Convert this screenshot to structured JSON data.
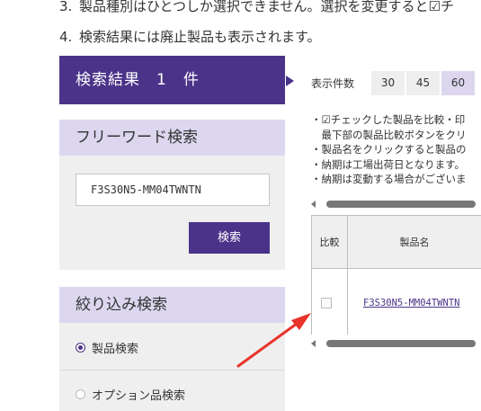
{
  "notes": {
    "n3_num": "3.",
    "n3_text": "製品種別はひとつしか選択できません。選択を変更すると☑チ",
    "n4_num": "4.",
    "n4_text": "検索結果には廃止製品も表示されます。"
  },
  "result": {
    "label": "検索結果　1　件"
  },
  "freeword": {
    "title": "フリーワード検索",
    "value": "F3S30N5-MM04TWNTN",
    "button": "検索"
  },
  "narrow": {
    "title": "絞り込み検索",
    "options": [
      {
        "label": "製品検索",
        "selected": true
      },
      {
        "label": "オプション品検索",
        "selected": false
      }
    ]
  },
  "count": {
    "label": "表示件数",
    "options": [
      "30",
      "45",
      "60"
    ],
    "selected": "60"
  },
  "bullets": [
    "・☑チェックした製品を比較・印",
    "　最下部の製品比較ボタンをクリ",
    "・製品名をクリックすると製品の",
    "・納期は工場出荷日となります。",
    "・納期は変動する場合がございま"
  ],
  "table": {
    "headers": [
      "比較",
      "製品名"
    ],
    "rows": [
      {
        "product": "F3S30N5-MM04TWNTN"
      }
    ]
  },
  "colors": {
    "accent": "#4a3389",
    "panel_head": "#dcd6ef",
    "annotation": "#e8332a"
  }
}
